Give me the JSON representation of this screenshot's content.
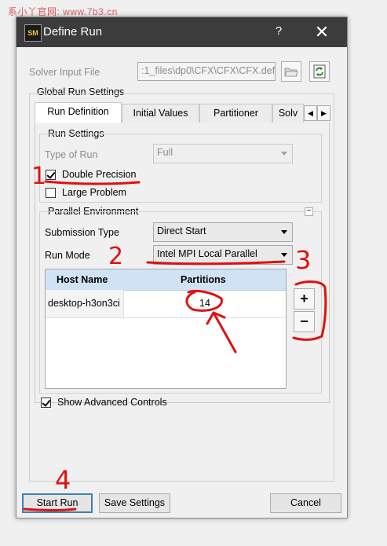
{
  "watermark": "系小丫官网: www.7b3.cn",
  "dialog": {
    "title": "Define Run",
    "logo_text": "SM",
    "help_label": "?",
    "close_label": "✕"
  },
  "solver_input": {
    "label": "Solver Input File",
    "value": ":1_files\\dp0\\CFX\\CFX\\CFX.def"
  },
  "global_settings": {
    "title": "Global Run Settings",
    "tabs": [
      {
        "label": "Run Definition"
      },
      {
        "label": "Initial Values"
      },
      {
        "label": "Partitioner"
      },
      {
        "label": "Solv"
      }
    ],
    "scroll_left": "◀",
    "scroll_right": "▶"
  },
  "run_settings": {
    "title": "Run Settings",
    "type_of_run_label": "Type of Run",
    "type_of_run_value": "Full",
    "double_precision_label": "Double Precision",
    "double_precision_checked": true,
    "large_problem_label": "Large Problem",
    "large_problem_checked": false
  },
  "parallel": {
    "title": "Parallel Environment",
    "collapse_symbol": "−",
    "submission_label": "Submission Type",
    "submission_value": "Direct Start",
    "run_mode_label": "Run Mode",
    "run_mode_value": "Intel MPI Local Parallel",
    "table": {
      "headers": [
        "Host Name",
        "Partitions"
      ],
      "rows": [
        {
          "host": "desktop-h3on3ci",
          "partitions": "14"
        }
      ]
    },
    "add_label": "+",
    "remove_label": "−"
  },
  "advanced": {
    "label": "Show Advanced Controls",
    "checked": true
  },
  "buttons": {
    "start": "Start Run",
    "save": "Save Settings",
    "cancel": "Cancel"
  },
  "annotations": [
    "1",
    "2",
    "3",
    "4"
  ],
  "colors": {
    "annotation": "#e01010",
    "titlebar": "#3c3c3c",
    "table_header": "#cfe3f5"
  }
}
